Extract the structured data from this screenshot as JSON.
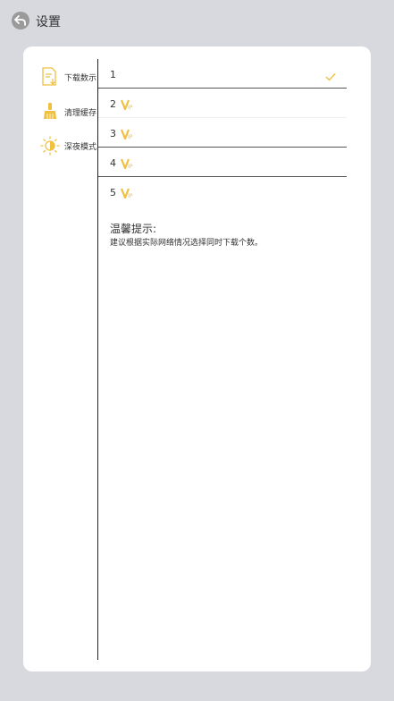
{
  "header": {
    "title": "设置"
  },
  "sidebar": {
    "items": [
      {
        "label": "下载数示",
        "icon": "download-doc-icon"
      },
      {
        "label": "清理缓存",
        "icon": "broom-icon"
      },
      {
        "label": "深夜模式",
        "icon": "sun-moon-icon"
      }
    ]
  },
  "options": [
    {
      "label": "1",
      "selected": true,
      "vip": false
    },
    {
      "label": "2",
      "selected": false,
      "vip": true
    },
    {
      "label": "3",
      "selected": false,
      "vip": true
    },
    {
      "label": "4",
      "selected": false,
      "vip": true
    },
    {
      "label": "5",
      "selected": false,
      "vip": true
    }
  ],
  "tip": {
    "title": "温馨提示:",
    "text": "建议根据实际网络情况选择同时下载个数。"
  },
  "colors": {
    "accent": "#f5c842",
    "background": "#d8d8df"
  }
}
